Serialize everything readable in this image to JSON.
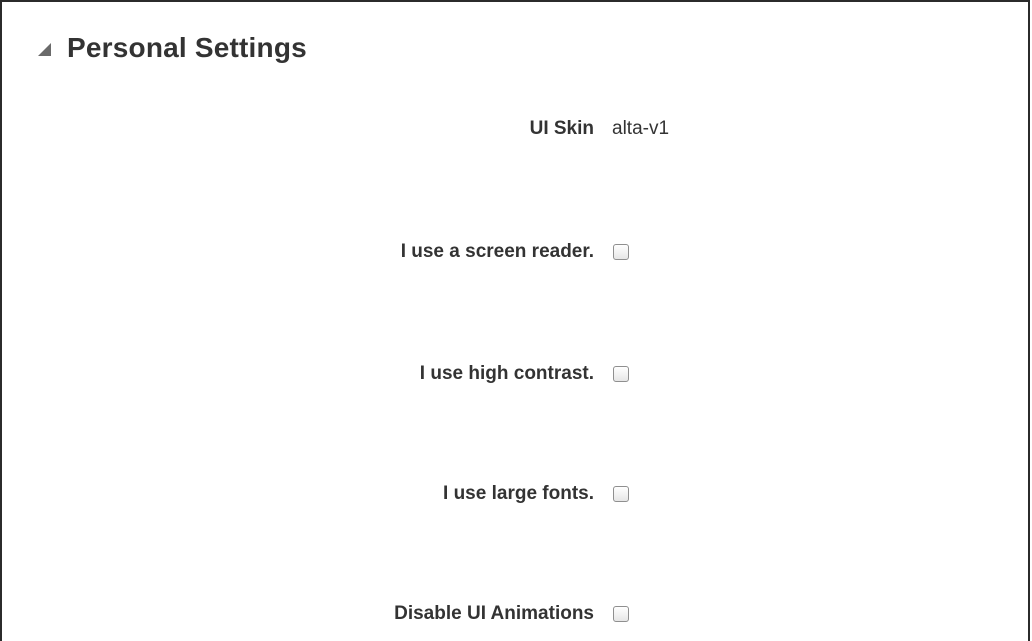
{
  "section": {
    "title": "Personal Settings",
    "expanded": true
  },
  "ui_skin": {
    "label": "UI Skin",
    "value": "alta-v1"
  },
  "options": [
    {
      "label": "I use a screen reader.",
      "checked": false
    },
    {
      "label": "I use high contrast.",
      "checked": false
    },
    {
      "label": "I use large fonts.",
      "checked": false
    },
    {
      "label": "Disable UI Animations",
      "checked": false
    }
  ],
  "colors": {
    "text": "#333333",
    "border": "#2b2b2b",
    "disclosure": "#6a6a6a",
    "checkbox_border": "#8f8f8f"
  }
}
